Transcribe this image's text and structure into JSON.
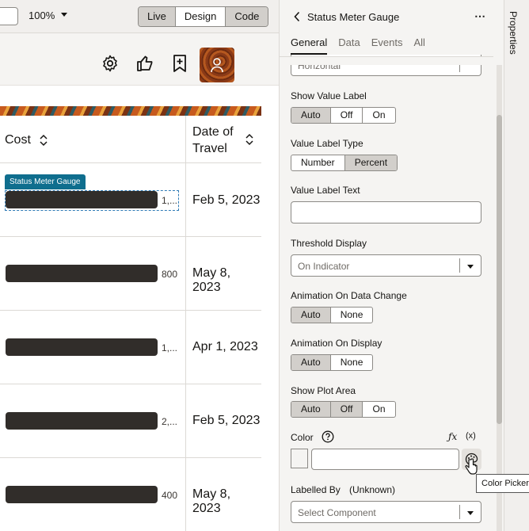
{
  "toolbar": {
    "zoom": "100%",
    "modes": [
      "Live",
      "Design",
      "Code"
    ],
    "active_mode": "Design"
  },
  "header_icons": [
    "settings-icon",
    "thumbs-up-icon",
    "bookmark-plus-icon",
    "user-avatar"
  ],
  "table": {
    "columns": [
      {
        "label": "Cost"
      },
      {
        "label": "Date of Travel",
        "line1": "Date of",
        "line2": "Travel"
      }
    ],
    "selected_component_tag": "Status Meter Gauge",
    "rows": [
      {
        "value_label": "1,...",
        "date": "Feb 5, 2023"
      },
      {
        "value_label": "800",
        "date": "May 8, 2023"
      },
      {
        "value_label": "1,...",
        "date": "Apr 1, 2023"
      },
      {
        "value_label": "2,...",
        "date": "Feb 5, 2023"
      },
      {
        "value_label": "400",
        "date": "May 8, 2023"
      }
    ]
  },
  "panel": {
    "title": "Status Meter Gauge",
    "tabs": [
      "General",
      "Data",
      "Events",
      "All"
    ],
    "active_tab": "General",
    "orientation_value": "Horizontal",
    "show_value_label": {
      "label": "Show Value Label",
      "options": [
        "Auto",
        "Off",
        "On"
      ],
      "selected": "Auto"
    },
    "value_label_type": {
      "label": "Value Label Type",
      "options": [
        "Number",
        "Percent"
      ],
      "selected": "Percent"
    },
    "value_label_text": {
      "label": "Value Label Text",
      "value": ""
    },
    "threshold_display": {
      "label": "Threshold Display",
      "value": "On Indicator"
    },
    "animation_on_data_change": {
      "label": "Animation On Data Change",
      "options": [
        "Auto",
        "None"
      ],
      "selected": "Auto"
    },
    "animation_on_display": {
      "label": "Animation On Display",
      "options": [
        "Auto",
        "None"
      ],
      "selected": "Auto"
    },
    "show_plot_area": {
      "label": "Show Plot Area",
      "options": [
        "Auto",
        "Off",
        "On"
      ],
      "selected": "Off"
    },
    "color": {
      "label": "Color",
      "fx": "ƒx",
      "var": "(x)",
      "value": ""
    },
    "labelled_by": {
      "label": "Labelled By",
      "hint": "(Unknown)",
      "placeholder": "Select Component"
    }
  },
  "side_tab": "Properties",
  "tooltip": "Color Picker"
}
